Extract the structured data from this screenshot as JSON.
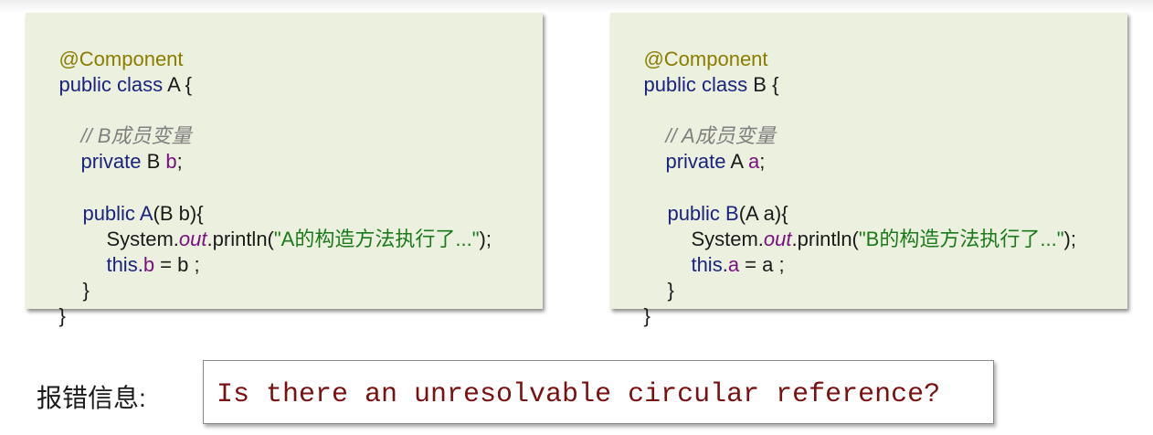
{
  "panel_a": {
    "annotation": "@Component",
    "decl_kw": "public class",
    "decl_name": " A {",
    "comment": "// B成员变量",
    "field_kw": "private",
    "field_type": " B ",
    "field_name": "b",
    "field_end": ";",
    "ctor_kw": "public",
    "ctor_name": " A",
    "ctor_params": "(B b){",
    "println_obj": "System.",
    "println_field": "out",
    "println_call": ".println(",
    "println_string": "\"A的构造方法执行了...\"",
    "println_end": ");",
    "assign_this": "this.",
    "assign_field": "b",
    "assign_rest": " = b ;",
    "close_inner": "}",
    "close_outer": "}"
  },
  "panel_b": {
    "annotation": "@Component",
    "decl_kw": "public class",
    "decl_name": " B {",
    "comment": "// A成员变量",
    "field_kw": "private",
    "field_type": " A ",
    "field_name": "a",
    "field_end": ";",
    "ctor_kw": "public",
    "ctor_name": " B",
    "ctor_params": "(A a){",
    "println_obj": "System.",
    "println_field": "out",
    "println_call": ".println(",
    "println_string": "\"B的构造方法执行了...\"",
    "println_end": ");",
    "assign_this": "this.",
    "assign_field": "a",
    "assign_rest": " = a ;",
    "close_inner": "}",
    "close_outer": "}"
  },
  "error": {
    "label": "报错信息:",
    "message": "Is there an unresolvable circular reference?"
  },
  "colors": {
    "panel_bg": "#ecf0df",
    "annotation": "#8a7d00",
    "keyword": "#1a237e",
    "field": "#7b1080",
    "comment": "#7f7f7f",
    "string": "#1a7a1a",
    "error_text": "#7a1010"
  }
}
